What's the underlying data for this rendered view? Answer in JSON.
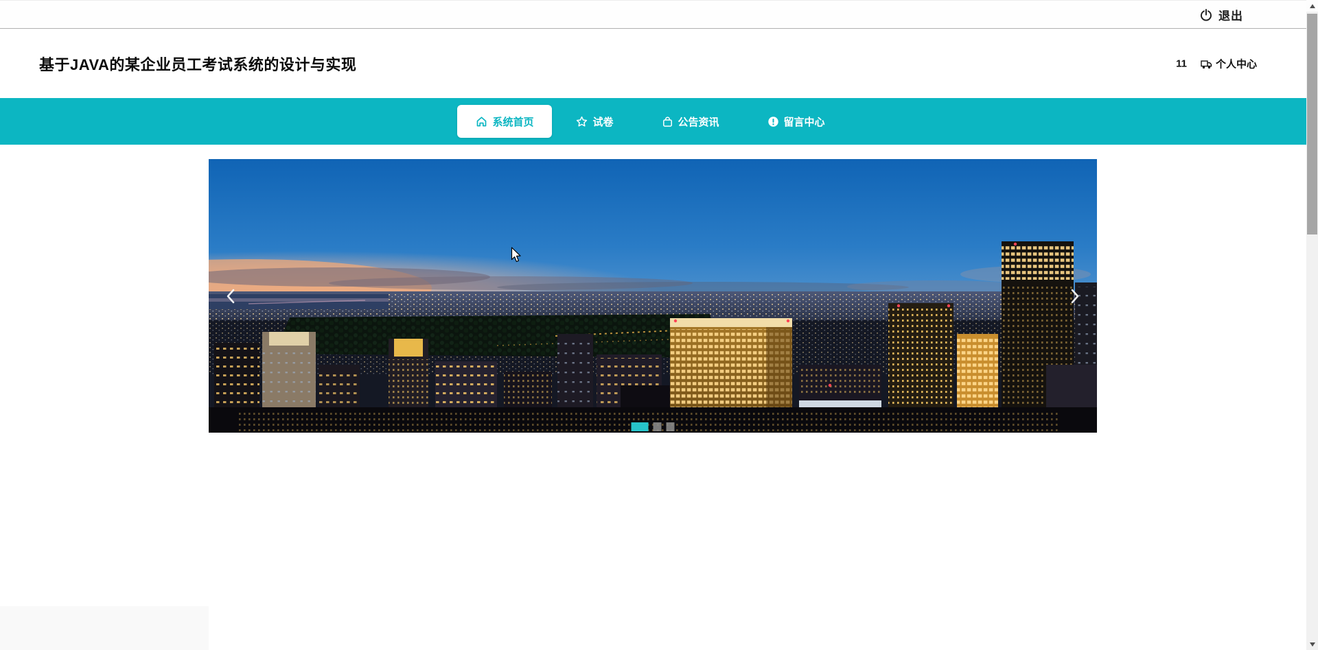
{
  "topbar": {
    "logout_label": "退出"
  },
  "header": {
    "title": "基于JAVA的某企业员工考试系统的设计与实现",
    "badge_count": "11",
    "profile_label": "个人中心"
  },
  "nav": {
    "items": [
      {
        "label": "系统首页",
        "icon": "home-icon",
        "active": true
      },
      {
        "label": "试卷",
        "icon": "star-icon",
        "active": false
      },
      {
        "label": "公告资讯",
        "icon": "bag-icon",
        "active": false
      },
      {
        "label": "留言中心",
        "icon": "info-icon",
        "active": false
      }
    ]
  },
  "carousel": {
    "slide_count": 3,
    "active_slide": 0,
    "image_alt": "night-city-skyline-banner"
  },
  "colors": {
    "accent": "#0cb6c2",
    "indicator_active": "#27c3c9",
    "indicator_inactive": "#8f8f8f"
  }
}
